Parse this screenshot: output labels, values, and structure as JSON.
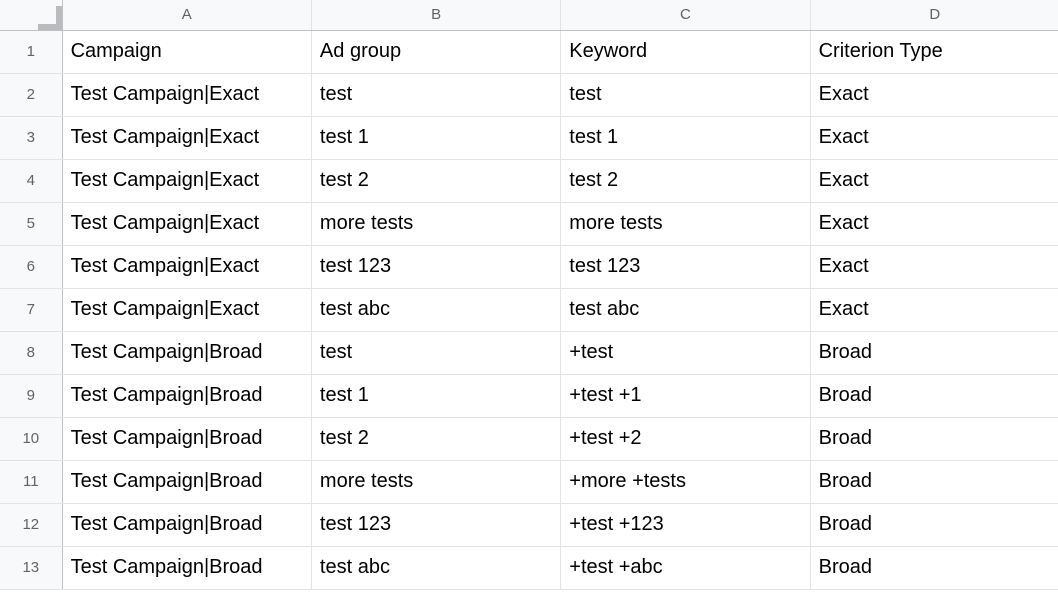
{
  "sheet": {
    "columns": [
      "A",
      "B",
      "C",
      "D"
    ],
    "row_numbers": [
      "1",
      "2",
      "3",
      "4",
      "5",
      "6",
      "7",
      "8",
      "9",
      "10",
      "11",
      "12",
      "13"
    ],
    "rows": [
      {
        "A": "Campaign",
        "B": "Ad group",
        "C": "Keyword",
        "D": "Criterion Type"
      },
      {
        "A": "Test Campaign|Exact",
        "B": "test",
        "C": "test",
        "D": "Exact"
      },
      {
        "A": "Test Campaign|Exact",
        "B": "test 1",
        "C": "test 1",
        "D": "Exact"
      },
      {
        "A": "Test Campaign|Exact",
        "B": "test 2",
        "C": "test 2",
        "D": "Exact"
      },
      {
        "A": "Test Campaign|Exact",
        "B": "more tests",
        "C": "more tests",
        "D": "Exact"
      },
      {
        "A": "Test Campaign|Exact",
        "B": "test 123",
        "C": "test 123",
        "D": "Exact"
      },
      {
        "A": "Test Campaign|Exact",
        "B": "test abc",
        "C": "test abc",
        "D": "Exact"
      },
      {
        "A": "Test Campaign|Broad",
        "B": "test",
        "C": "+test",
        "D": "Broad"
      },
      {
        "A": "Test Campaign|Broad",
        "B": "test 1",
        "C": "+test +1",
        "D": "Broad"
      },
      {
        "A": "Test Campaign|Broad",
        "B": "test 2",
        "C": "+test +2",
        "D": "Broad"
      },
      {
        "A": "Test Campaign|Broad",
        "B": "more tests",
        "C": "+more +tests",
        "D": "Broad"
      },
      {
        "A": "Test Campaign|Broad",
        "B": "test 123",
        "C": "+test +123",
        "D": "Broad"
      },
      {
        "A": "Test Campaign|Broad",
        "B": "test abc",
        "C": "+test +abc",
        "D": "Broad"
      }
    ]
  },
  "chart_data": {
    "type": "table",
    "title": "",
    "columns": [
      "Campaign",
      "Ad group",
      "Keyword",
      "Criterion Type"
    ],
    "rows": [
      [
        "Test Campaign|Exact",
        "test",
        "test",
        "Exact"
      ],
      [
        "Test Campaign|Exact",
        "test 1",
        "test 1",
        "Exact"
      ],
      [
        "Test Campaign|Exact",
        "test 2",
        "test 2",
        "Exact"
      ],
      [
        "Test Campaign|Exact",
        "more tests",
        "more tests",
        "Exact"
      ],
      [
        "Test Campaign|Exact",
        "test 123",
        "test 123",
        "Exact"
      ],
      [
        "Test Campaign|Exact",
        "test abc",
        "test abc",
        "Exact"
      ],
      [
        "Test Campaign|Broad",
        "test",
        "+test",
        "Broad"
      ],
      [
        "Test Campaign|Broad",
        "test 1",
        "+test +1",
        "Broad"
      ],
      [
        "Test Campaign|Broad",
        "test 2",
        "+test +2",
        "Broad"
      ],
      [
        "Test Campaign|Broad",
        "more tests",
        "+more +tests",
        "Broad"
      ],
      [
        "Test Campaign|Broad",
        "test 123",
        "+test +123",
        "Broad"
      ],
      [
        "Test Campaign|Broad",
        "test abc",
        "+test +abc",
        "Broad"
      ]
    ]
  }
}
